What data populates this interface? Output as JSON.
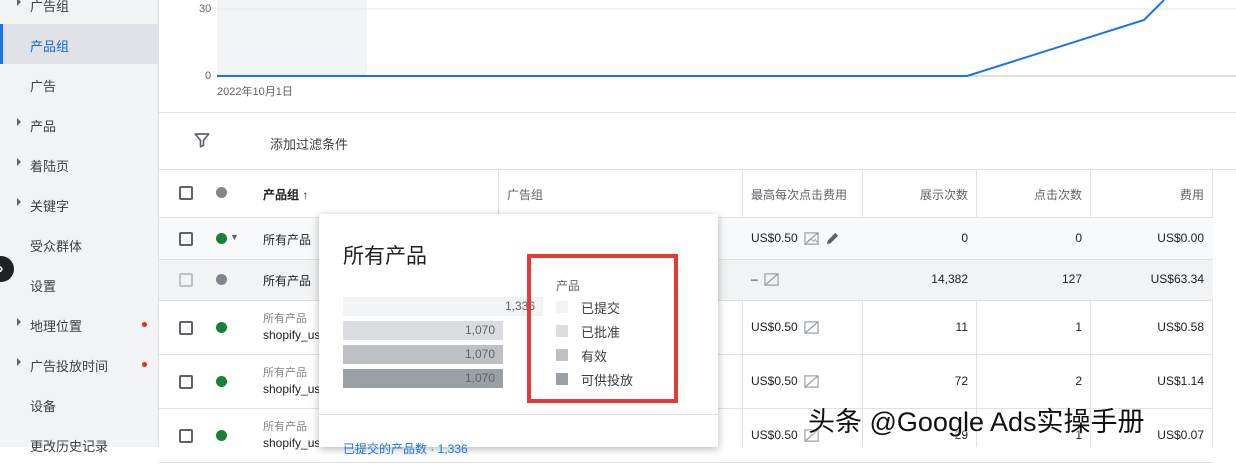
{
  "sidebar": {
    "items": [
      {
        "label": "广告组",
        "expandable": true
      },
      {
        "label": "产品组",
        "expandable": false,
        "active": true
      },
      {
        "label": "广告",
        "expandable": false
      },
      {
        "label": "产品",
        "expandable": true
      },
      {
        "label": "着陆页",
        "expandable": true
      },
      {
        "label": "关键字",
        "expandable": true
      },
      {
        "label": "受众群体",
        "expandable": false
      },
      {
        "label": "设置",
        "expandable": false
      },
      {
        "label": "地理位置",
        "expandable": true,
        "alert": true
      },
      {
        "label": "广告投放时间",
        "expandable": true,
        "alert": true
      },
      {
        "label": "设备",
        "expandable": false
      },
      {
        "label": "更改历史记录",
        "expandable": false
      }
    ],
    "collapse_icon": "chevron-right-icon"
  },
  "chart": {
    "y_ticks": [
      "30",
      "0"
    ],
    "x_start_label": "2022年10月1日",
    "line_color": "#1a73e8"
  },
  "filter_bar": {
    "icon": "filter-icon",
    "add_filter_label": "添加过滤条件"
  },
  "table": {
    "headers": {
      "product_group": "产品组",
      "sort_icon": "arrow-up-icon",
      "ad_group": "广告组",
      "max_cpc": "最高每次点击费用",
      "impressions": "展示次数",
      "clicks": "点击次数",
      "cost": "费用"
    },
    "rows": [
      {
        "status": "green",
        "name": "所有产品",
        "bid": "US$0.50",
        "impressions": "0",
        "clicks": "0",
        "cost": "US$0.00",
        "editable": true
      },
      {
        "status": "gray",
        "name": "所有产品",
        "bid": "–",
        "impressions": "14,382",
        "clicks": "127",
        "cost": "US$63.34",
        "total": true
      },
      {
        "status": "green",
        "name": "所有产品",
        "sub": "shopify_us",
        "bid": "US$0.50",
        "impressions": "11",
        "clicks": "1",
        "cost": "US$0.58"
      },
      {
        "status": "green",
        "name": "所有产品",
        "sub": "shopify_us",
        "bid": "US$0.50",
        "impressions": "72",
        "clicks": "2",
        "cost": "US$1.14"
      },
      {
        "status": "green",
        "name": "所有产品",
        "sub": "shopify_us",
        "bid": "US$0.50",
        "impressions": "29",
        "clicks": "1",
        "cost": "US$0.07"
      }
    ]
  },
  "popup": {
    "title": "所有产品",
    "bars": [
      {
        "value": "1,336",
        "fraction": 1.0,
        "color": "#f1f3f4"
      },
      {
        "value": "1,070",
        "fraction": 0.8,
        "color": "#dadce0"
      },
      {
        "value": "1,070",
        "fraction": 0.8,
        "color": "#bdc1c6"
      },
      {
        "value": "1,070",
        "fraction": 0.8,
        "color": "#9aa0a6"
      }
    ],
    "legend_title": "产品",
    "legend": [
      {
        "label": "已提交",
        "color": "#f1f3f4"
      },
      {
        "label": "已批准",
        "color": "#dadce0"
      },
      {
        "label": "有效",
        "color": "#bdc1c6"
      },
      {
        "label": "可供投放",
        "color": "#9aa0a6"
      }
    ],
    "link": "已提交的产品数 · 1,336",
    "highlight_color": "#e53935"
  },
  "watermark": "头条 @Google Ads实操手册"
}
